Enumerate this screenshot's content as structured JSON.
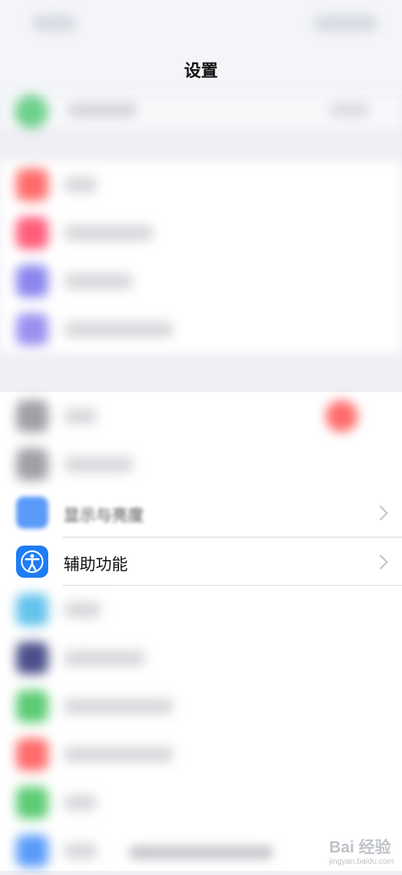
{
  "header": {
    "title": "设置"
  },
  "visible_rows": [
    {
      "label": "显示与亮度",
      "icon": "display-brightness-icon",
      "color": "#3d8af7"
    },
    {
      "label": "辅助功能",
      "icon": "accessibility-icon",
      "color": "#1e7cf5"
    }
  ],
  "watermark": {
    "brand": "Bai 经验",
    "url": "jingyan.baidu.com"
  }
}
